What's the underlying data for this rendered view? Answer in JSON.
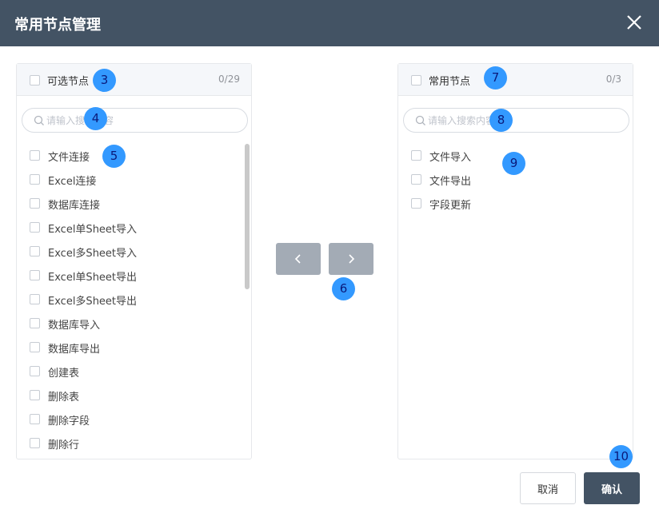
{
  "dialog": {
    "title": "常用节点管理",
    "close_icon": "close-icon"
  },
  "left_panel": {
    "title": "可选节点",
    "count": "0/29",
    "search_placeholder": "请输入搜索内容",
    "items": [
      "文件连接",
      "Excel连接",
      "数据库连接",
      "Excel单Sheet导入",
      "Excel多Sheet导入",
      "Excel单Sheet导出",
      "Excel多Sheet导出",
      "数据库导入",
      "数据库导出",
      "创建表",
      "删除表",
      "删除字段",
      "删除行"
    ]
  },
  "right_panel": {
    "title": "常用节点",
    "count": "0/3",
    "search_placeholder": "请输入搜索内容",
    "items": [
      "文件导入",
      "文件导出",
      "字段更新"
    ]
  },
  "transfer": {
    "left_icon": "chevron-left-icon",
    "right_icon": "chevron-right-icon"
  },
  "footer": {
    "cancel_label": "取消",
    "confirm_label": "确认"
  },
  "markers": [
    "3",
    "4",
    "5",
    "6",
    "7",
    "8",
    "9",
    "10"
  ],
  "colors": {
    "header_bg": "#435364",
    "transfer_button": "#a3abb5",
    "marker_bg": "#3399ff"
  }
}
